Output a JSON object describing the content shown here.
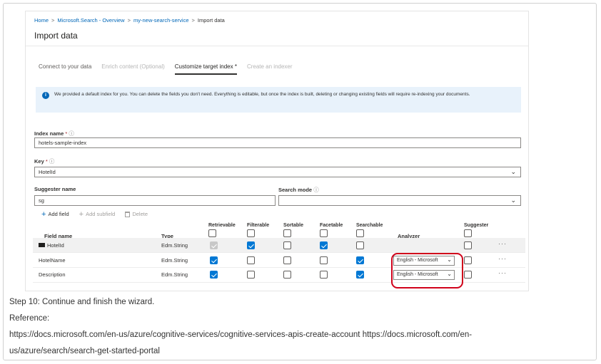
{
  "breadcrumb": {
    "items": [
      "Home",
      "Microsoft.Search - Overview",
      "my-new-search-service",
      "Import data"
    ]
  },
  "page_title": "Import data",
  "tabs": [
    {
      "label": "Connect to your data",
      "state": "normal"
    },
    {
      "label": "Enrich content (Optional)",
      "state": "disabled"
    },
    {
      "label": "Customize target index *",
      "state": "active"
    },
    {
      "label": "Create an indexer",
      "state": "disabled"
    }
  ],
  "info_banner": {
    "icon": "info-icon",
    "text": "We provided a default index for you. You can delete the fields you don't need. Everything is editable, but once the index is built, deleting or changing existing fields will require re-indexing your documents."
  },
  "form": {
    "index_name_label": "Index name",
    "index_name_value": "hotels-sample-index",
    "key_label": "Key",
    "key_value": "HotelId",
    "suggester_label": "Suggester name",
    "suggester_value": "sg",
    "search_mode_label": "Search mode",
    "search_mode_value": "",
    "required_mark": "*",
    "tip_mark": "ⓘ"
  },
  "toolbar": {
    "add_field": "Add field",
    "add_subfield": "Add subfield",
    "delete": "Delete"
  },
  "table": {
    "columns": [
      "Field name",
      "Type",
      "Retrievable",
      "Filterable",
      "Sortable",
      "Facetable",
      "Searchable",
      "Analyzer",
      "Suggester"
    ],
    "rows": [
      {
        "name": "HotelId",
        "type": "Edm.String",
        "is_key": true,
        "retrievable": "disabled-checked",
        "filterable": true,
        "sortable": false,
        "facetable": true,
        "searchable": false,
        "analyzer": "",
        "suggester": false
      },
      {
        "name": "HotelName",
        "type": "Edm.String",
        "is_key": false,
        "retrievable": true,
        "filterable": false,
        "sortable": false,
        "facetable": false,
        "searchable": true,
        "analyzer": "English - Microsoft",
        "suggester": false
      },
      {
        "name": "Description",
        "type": "Edm.String",
        "is_key": false,
        "retrievable": true,
        "filterable": false,
        "sortable": false,
        "facetable": false,
        "searchable": true,
        "analyzer": "English - Microsoft",
        "suggester": false
      }
    ],
    "more_glyph": "···"
  },
  "caption": {
    "step": "Step 10: Continue and finish the wizard.",
    "reference_label": "Reference:",
    "links_line1": "https://docs.microsoft.com/en-us/azure/cognitive-services/cognitive-services-apis-create-account https://docs.microsoft.com/en-",
    "links_line2": "us/azure/search/search-get-started-portal"
  },
  "colors": {
    "accent": "#0078d4",
    "link": "#0067b8",
    "highlight": "#d0021b",
    "banner_bg": "#e8f2fb"
  }
}
